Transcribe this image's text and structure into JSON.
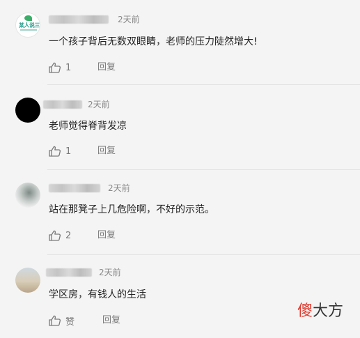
{
  "comments": [
    {
      "avatar": "logo-avatar",
      "avatar_logo_text": "某人说三",
      "time": "2天前",
      "text": "一个孩子背后无数双眼睛，老师的压力陡然增大!",
      "likes": "1",
      "reply_label": "回复"
    },
    {
      "avatar": "black-avatar",
      "time": "2天前",
      "text": "老师觉得脊背发凉",
      "likes": "1",
      "reply_label": "回复"
    },
    {
      "avatar": "photo-avatar",
      "time": "2天前",
      "text": "站在那凳子上几危险啊，不好的示范。",
      "likes": "2",
      "reply_label": "回复"
    },
    {
      "avatar": "photo-avatar",
      "time": "2天前",
      "text": "学区房，有钱人的生活",
      "likes": "赞",
      "reply_label": "回复"
    }
  ],
  "icons": {
    "like": "thumbs-up-icon"
  },
  "watermark": {
    "char1": "傻",
    "rest": "大方"
  },
  "colors": {
    "background": "#f4f4f4",
    "text": "#222222",
    "meta": "#888888",
    "watermark_accent": "#e03a2f"
  }
}
